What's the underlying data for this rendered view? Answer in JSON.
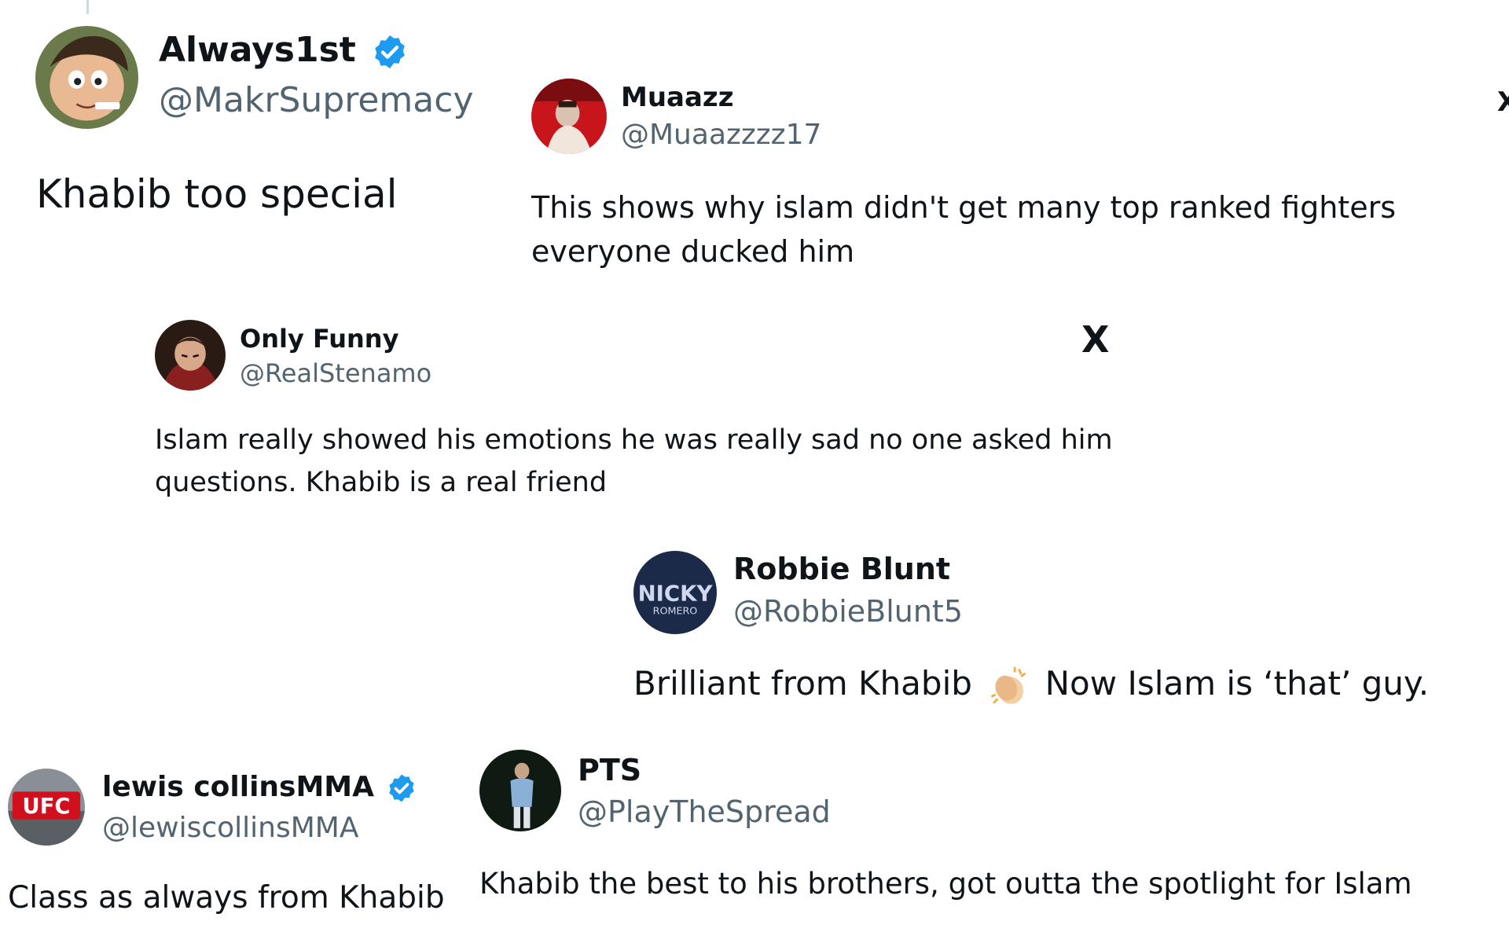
{
  "posts": [
    {
      "name": "Always1st",
      "handle": "@MakrSupremacy",
      "verified": true,
      "text": "Khabib too special",
      "avatar_icon": "cartoon-avatar-icon"
    },
    {
      "name": "Muaazz",
      "handle": "@Muaazzzz17",
      "verified": false,
      "text": "This shows why islam didn't get many top ranked fighters everyone ducked him",
      "avatar_icon": "fighter-avatar-icon"
    },
    {
      "name": "Only Funny",
      "handle": "@RealStenamo",
      "verified": false,
      "text": "Islam really showed his emotions he was really sad no one asked him questions. Khabib is a real friend",
      "avatar_icon": "anime-avatar-icon"
    },
    {
      "name": "Robbie Blunt",
      "handle": "@RobbieBlunt5",
      "verified": false,
      "text_before": "Brilliant from Khabib",
      "text_after": "Now Islam is ‘that’ guy.",
      "avatar_icon": "nicky-romero-avatar-icon",
      "avatar_text": "NICKY",
      "avatar_subtext": "ROMERO"
    },
    {
      "name": "lewis collinsMMA",
      "handle": "@lewiscollinsMMA",
      "verified": true,
      "text": "Class as always from Khabib",
      "avatar_icon": "ufc-avatar-icon",
      "avatar_text": "UFC"
    },
    {
      "name": "PTS",
      "handle": "@PlayTheSpread",
      "verified": false,
      "text": "Khabib the best to his brothers, got outta the spotlight for Islam",
      "avatar_icon": "athlete-avatar-icon"
    }
  ],
  "x_logo": "X",
  "colors": {
    "text": "#0f1419",
    "handle": "#536471",
    "verified": "#1d9bf0"
  }
}
